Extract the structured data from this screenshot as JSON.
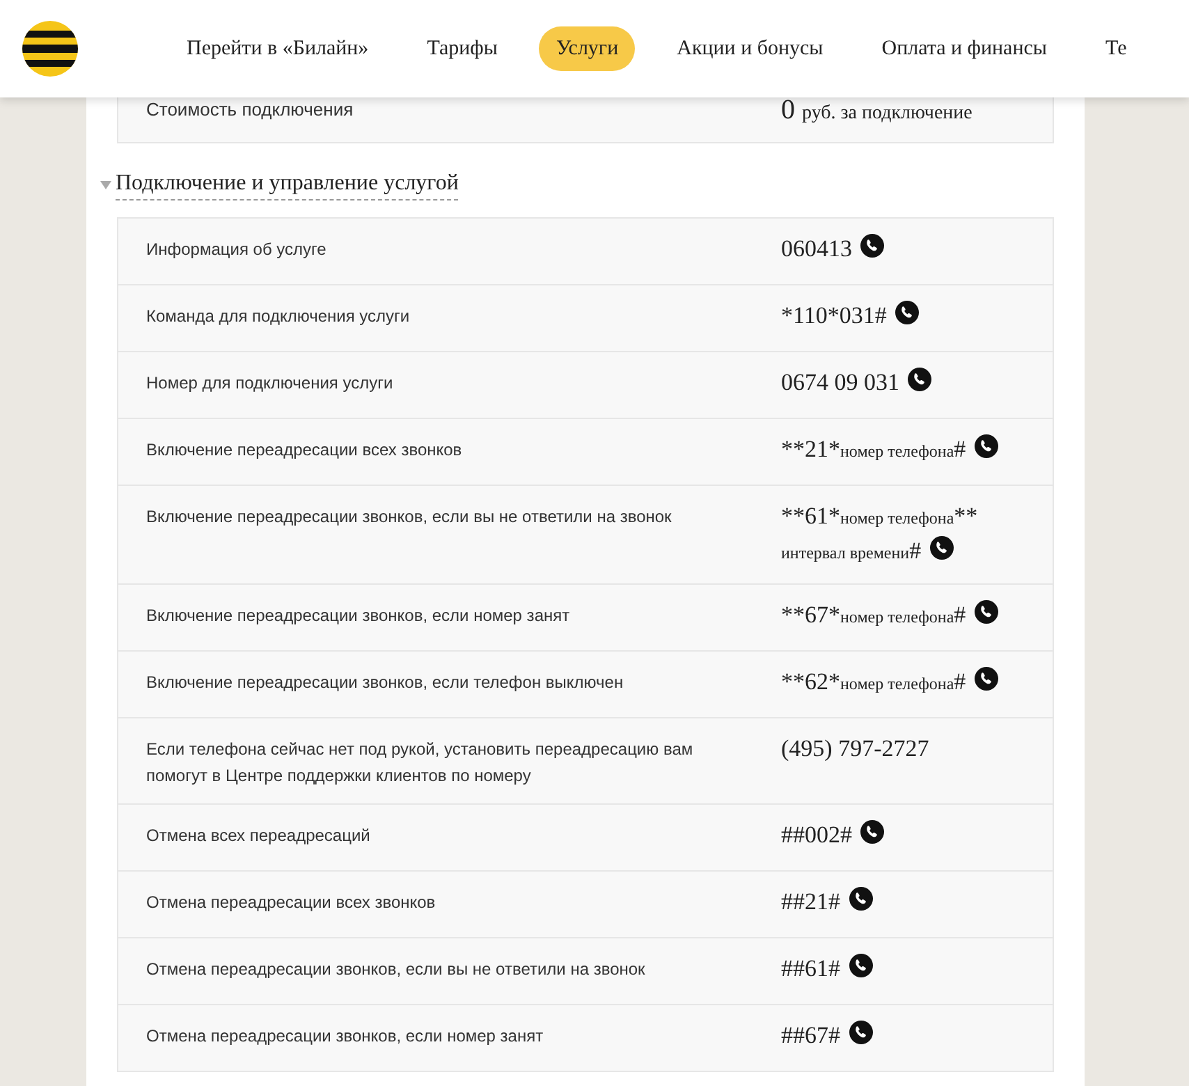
{
  "nav": [
    {
      "label": "Перейти в «Билайн»",
      "selected": false
    },
    {
      "label": "Тарифы",
      "selected": false
    },
    {
      "label": "Услуги",
      "selected": true
    },
    {
      "label": "Акции и бонусы",
      "selected": false
    },
    {
      "label": "Оплата и финансы",
      "selected": false
    },
    {
      "label": "Те",
      "selected": false
    }
  ],
  "cost_row": {
    "label": "Стоимость подключения",
    "amount": "0",
    "unit": "руб. за подключение"
  },
  "section": {
    "title": "Подключение и управление услугой",
    "expanded": true
  },
  "rows": [
    {
      "label": "Информация об услуге",
      "parts": [
        {
          "kind": "code",
          "text": "060413"
        }
      ],
      "phone_icon": true
    },
    {
      "label": "Команда для подключения услуги",
      "parts": [
        {
          "kind": "code",
          "text": "*110*031#"
        }
      ],
      "phone_icon": true
    },
    {
      "label": "Номер для подключения услуги",
      "parts": [
        {
          "kind": "code",
          "text": "0674 09 031"
        }
      ],
      "phone_icon": true
    },
    {
      "label": "Включение переадресации всех звонков",
      "parts": [
        {
          "kind": "code",
          "text": "**21*"
        },
        {
          "kind": "hint",
          "text": "номер телефона"
        },
        {
          "kind": "code",
          "text": "#"
        }
      ],
      "phone_icon": true
    },
    {
      "label": "Включение переадресации звонков, если вы не ответили на звонок",
      "parts": [
        {
          "kind": "code",
          "text": "**61*"
        },
        {
          "kind": "hint",
          "text": "номер телефона"
        },
        {
          "kind": "code",
          "text": "**"
        },
        {
          "kind": "hint",
          "text": "интервал времени"
        },
        {
          "kind": "code",
          "text": "#"
        }
      ],
      "phone_icon": true
    },
    {
      "label": "Включение переадресации звонков, если номер занят",
      "parts": [
        {
          "kind": "code",
          "text": "**67*"
        },
        {
          "kind": "hint",
          "text": "номер телефона"
        },
        {
          "kind": "code",
          "text": "#"
        }
      ],
      "phone_icon": true
    },
    {
      "label": "Включение переадресации звонков, если телефон выключен",
      "parts": [
        {
          "kind": "code",
          "text": "**62*"
        },
        {
          "kind": "hint",
          "text": "номер телефона"
        },
        {
          "kind": "code",
          "text": "#"
        }
      ],
      "phone_icon": true
    },
    {
      "label": "Если телефона сейчас нет под рукой, установить переадресацию вам помогут в Центре поддержки клиентов по номеру",
      "parts": [
        {
          "kind": "code",
          "text": "(495) 797-2727"
        }
      ],
      "phone_icon": false
    },
    {
      "label": "Отмена всех переадресаций",
      "parts": [
        {
          "kind": "code",
          "text": "##002#"
        }
      ],
      "phone_icon": true
    },
    {
      "label": "Отмена переадресации всех звонков",
      "parts": [
        {
          "kind": "code",
          "text": "##21#"
        }
      ],
      "phone_icon": true
    },
    {
      "label": "Отмена переадресации звонков, если вы не ответили на звонок",
      "parts": [
        {
          "kind": "code",
          "text": "##61#"
        }
      ],
      "phone_icon": true
    },
    {
      "label": "Отмена переадресации звонков, если номер занят",
      "parts": [
        {
          "kind": "code",
          "text": "##67#"
        }
      ],
      "phone_icon": true
    }
  ]
}
